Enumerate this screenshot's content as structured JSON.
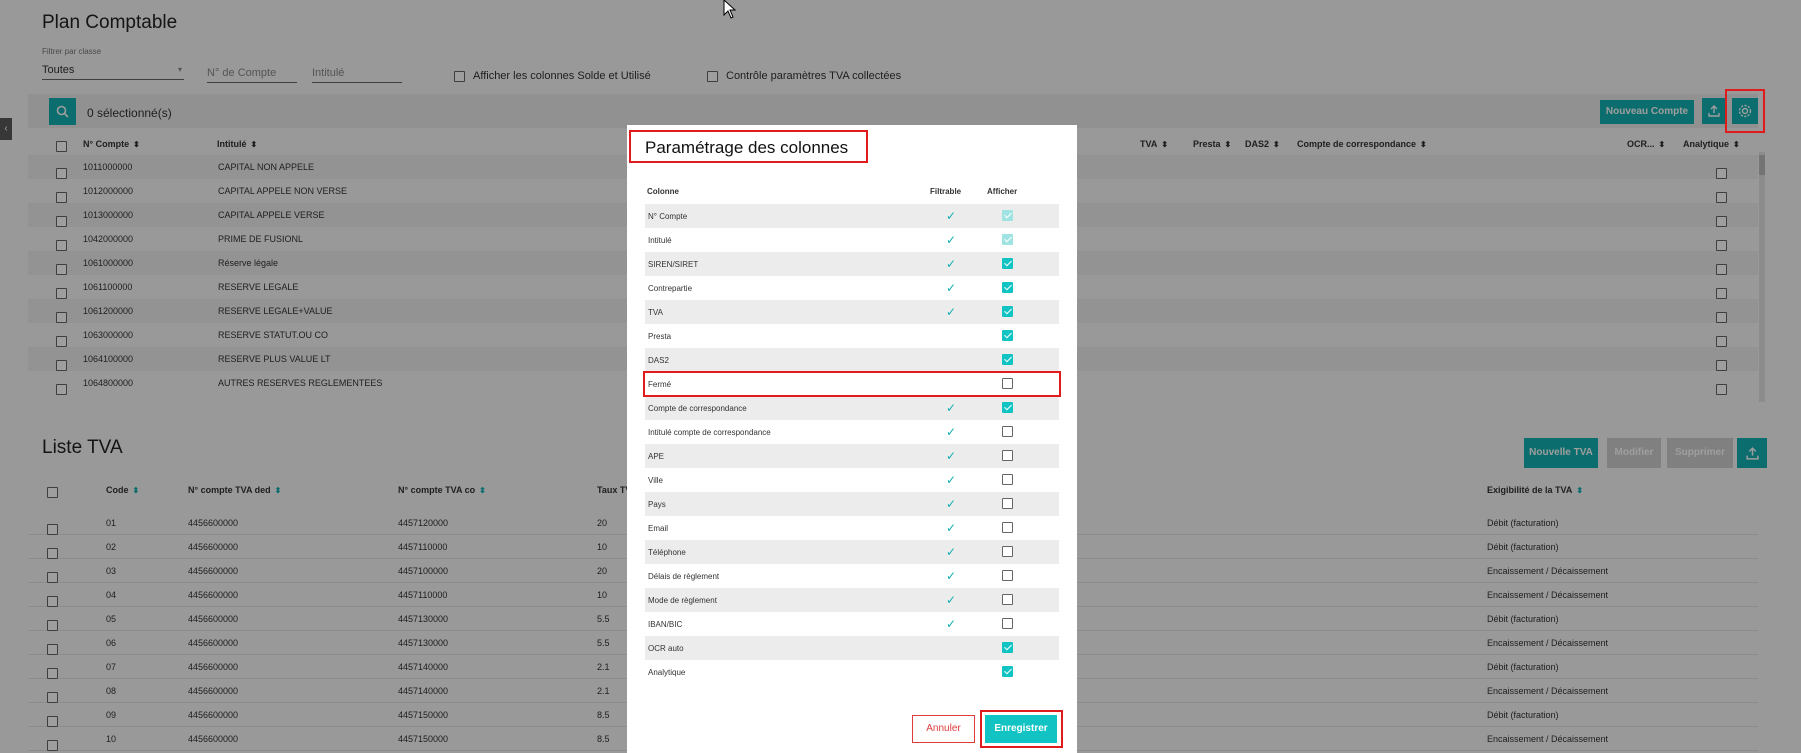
{
  "plan": {
    "title": "Plan Comptable",
    "filter_label": "Filtrer par classe",
    "filter_value": "Toutes",
    "compte_placeholder": "N° de Compte",
    "intitule_placeholder": "Intitulé",
    "check_solde": "Afficher les colonnes Solde et Utilisé",
    "check_tva": "Contrôle paramètres TVA collectées",
    "selected_count": "0 sélectionné(s)",
    "new_account": "Nouveau Compte",
    "columns": {
      "compte": "N° Compte",
      "intitule": "Intitulé",
      "tva": "TVA",
      "presta": "Presta",
      "das2": "DAS2",
      "correspondance": "Compte de correspondance",
      "ocr": "OCR...",
      "analytique": "Analytique"
    },
    "rows": [
      {
        "compte": "1011000000",
        "intitule": "CAPITAL NON APPELE"
      },
      {
        "compte": "1012000000",
        "intitule": "CAPITAL APPELE NON VERSE"
      },
      {
        "compte": "1013000000",
        "intitule": "CAPITAL APPELE VERSE"
      },
      {
        "compte": "1042000000",
        "intitule": "PRIME DE FUSIONL"
      },
      {
        "compte": "1061000000",
        "intitule": "Réserve légale"
      },
      {
        "compte": "1061100000",
        "intitule": "RESERVE LEGALE"
      },
      {
        "compte": "1061200000",
        "intitule": "RESERVE LEGALE+VALUE"
      },
      {
        "compte": "1063000000",
        "intitule": "RESERVE STATUT.OU CO"
      },
      {
        "compte": "1064100000",
        "intitule": "RESERVE PLUS VALUE LT"
      },
      {
        "compte": "1064800000",
        "intitule": "AUTRES RESERVES REGLEMENTEES"
      }
    ]
  },
  "tva": {
    "title": "Liste TVA",
    "new": "Nouvelle TVA",
    "modify": "Modifier",
    "delete": "Supprimer",
    "columns": {
      "code": "Code",
      "ded": "N° compte TVA ded",
      "co": "N° compte TVA co",
      "taux": "Taux TV",
      "exig": "Exigibilité de la TVA"
    },
    "rows": [
      {
        "code": "01",
        "ded": "4456600000",
        "co": "4457120000",
        "taux": "20",
        "exig": "Débit (facturation)"
      },
      {
        "code": "02",
        "ded": "4456600000",
        "co": "4457110000",
        "taux": "10",
        "exig": "Débit (facturation)"
      },
      {
        "code": "03",
        "ded": "4456600000",
        "co": "4457100000",
        "taux": "20",
        "exig": "Encaissement / Décaissement"
      },
      {
        "code": "04",
        "ded": "4456600000",
        "co": "4457110000",
        "taux": "10",
        "exig": "Encaissement / Décaissement"
      },
      {
        "code": "05",
        "ded": "4456600000",
        "co": "4457130000",
        "taux": "5.5",
        "exig": "Débit (facturation)"
      },
      {
        "code": "06",
        "ded": "4456600000",
        "co": "4457130000",
        "taux": "5.5",
        "exig": "Encaissement / Décaissement"
      },
      {
        "code": "07",
        "ded": "4456600000",
        "co": "4457140000",
        "taux": "2.1",
        "exig": "Débit (facturation)"
      },
      {
        "code": "08",
        "ded": "4456600000",
        "co": "4457140000",
        "taux": "2.1",
        "exig": "Encaissement / Décaissement"
      },
      {
        "code": "09",
        "ded": "4456600000",
        "co": "4457150000",
        "taux": "8.5",
        "exig": "Débit (facturation)"
      },
      {
        "code": "10",
        "ded": "4456600000",
        "co": "4457150000",
        "taux": "8.5",
        "exig": "Encaissement / Décaissement"
      }
    ]
  },
  "modal": {
    "title": "Paramétrage des colonnes",
    "col_header": "Colonne",
    "filter_header": "Filtrable",
    "show_header": "Afficher",
    "cancel": "Annuler",
    "save": "Enregistrer",
    "rows": [
      {
        "label": "N° Compte",
        "filtrable": true,
        "state": "disabled"
      },
      {
        "label": "Intitulé",
        "filtrable": true,
        "state": "disabled"
      },
      {
        "label": "SIREN/SIRET",
        "filtrable": true,
        "state": "checked"
      },
      {
        "label": "Contrepartie",
        "filtrable": true,
        "state": "checked"
      },
      {
        "label": "TVA",
        "filtrable": true,
        "state": "checked"
      },
      {
        "label": "Presta",
        "filtrable": false,
        "state": "checked"
      },
      {
        "label": "DAS2",
        "filtrable": false,
        "state": "checked"
      },
      {
        "label": "Fermé",
        "filtrable": false,
        "state": "unchecked"
      },
      {
        "label": "Compte de correspondance",
        "filtrable": true,
        "state": "checked"
      },
      {
        "label": "Intitulé compte de correspondance",
        "filtrable": true,
        "state": "unchecked"
      },
      {
        "label": "APE",
        "filtrable": true,
        "state": "unchecked"
      },
      {
        "label": "Ville",
        "filtrable": true,
        "state": "unchecked"
      },
      {
        "label": "Pays",
        "filtrable": true,
        "state": "unchecked"
      },
      {
        "label": "Email",
        "filtrable": true,
        "state": "unchecked"
      },
      {
        "label": "Téléphone",
        "filtrable": true,
        "state": "unchecked"
      },
      {
        "label": "Délais de règlement",
        "filtrable": true,
        "state": "unchecked"
      },
      {
        "label": "Mode de règlement",
        "filtrable": true,
        "state": "unchecked"
      },
      {
        "label": "IBAN/BIC",
        "filtrable": true,
        "state": "unchecked"
      },
      {
        "label": "OCR auto",
        "filtrable": false,
        "state": "checked"
      },
      {
        "label": "Analytique",
        "filtrable": false,
        "state": "checked"
      }
    ]
  },
  "colors": {
    "accent": "#12b0b0",
    "highlight": "#e01b1b"
  }
}
